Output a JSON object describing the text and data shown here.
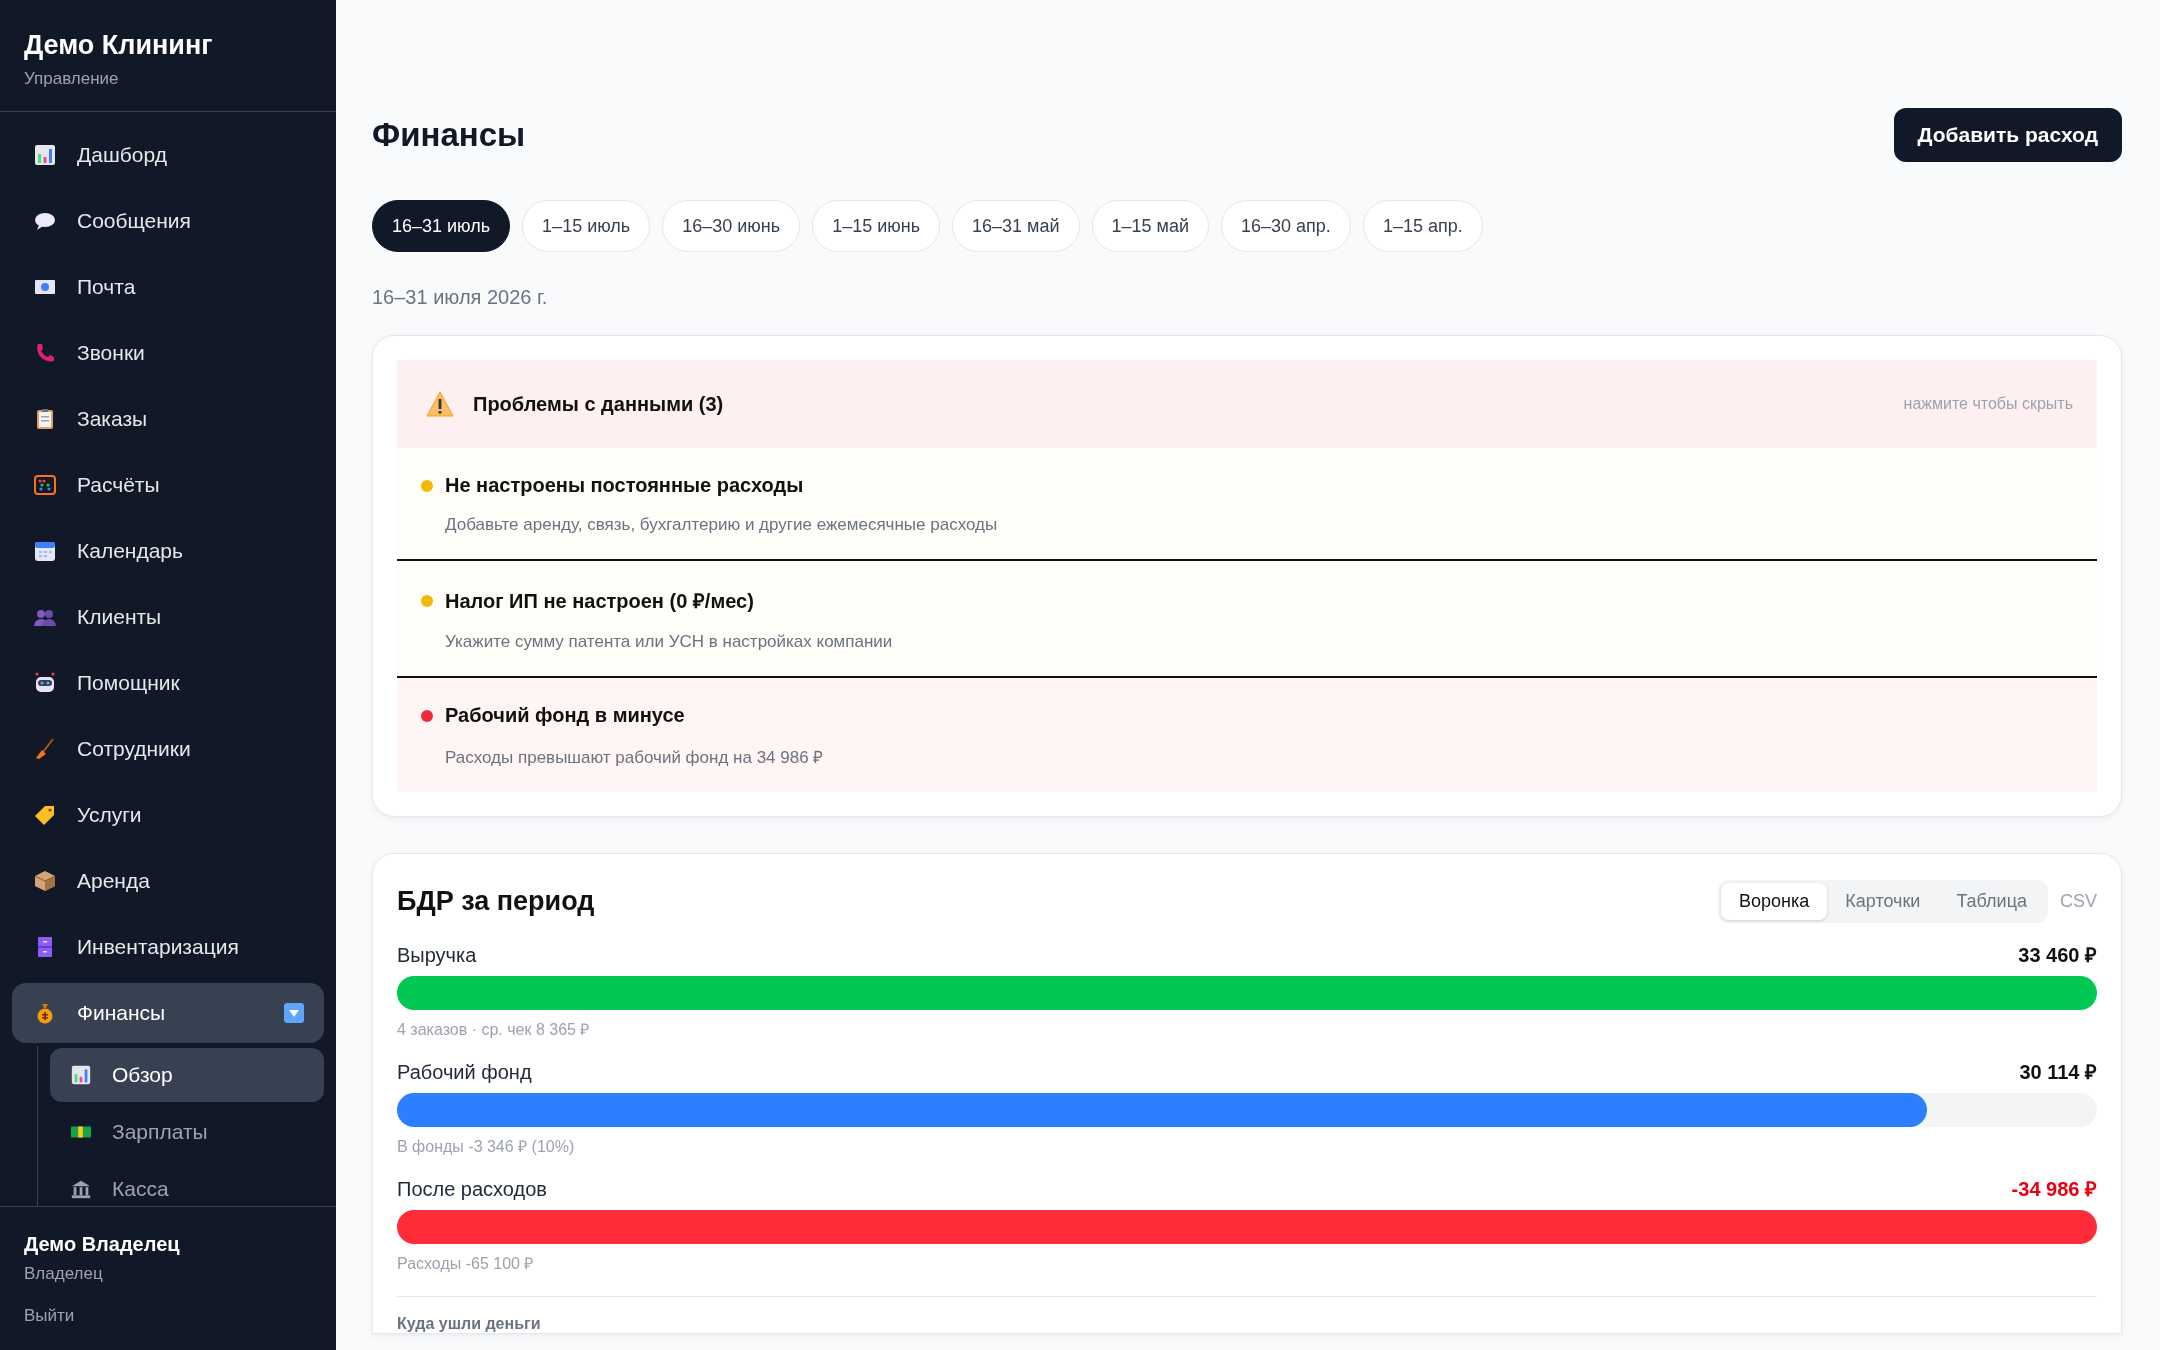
{
  "sidebar": {
    "title": "Демо Клининг",
    "subtitle": "Управление",
    "items": [
      {
        "label": "Дашборд",
        "selected": false
      },
      {
        "label": "Сообщения",
        "selected": false
      },
      {
        "label": "Почта",
        "selected": false
      },
      {
        "label": "Звонки",
        "selected": false
      },
      {
        "label": "Заказы",
        "selected": false
      },
      {
        "label": "Расчёты",
        "selected": false
      },
      {
        "label": "Календарь",
        "selected": false
      },
      {
        "label": "Клиенты",
        "selected": false
      },
      {
        "label": "Помощник",
        "selected": false
      },
      {
        "label": "Сотрудники",
        "selected": false
      },
      {
        "label": "Услуги",
        "selected": false
      },
      {
        "label": "Аренда",
        "selected": false
      },
      {
        "label": "Инвентаризация",
        "selected": false
      },
      {
        "label": "Финансы",
        "selected": true,
        "expanded": true,
        "children": [
          {
            "label": "Обзор",
            "selected": true
          },
          {
            "label": "Зарплаты",
            "selected": false
          },
          {
            "label": "Касса",
            "selected": false
          }
        ]
      }
    ],
    "user": {
      "name": "Демо Владелец",
      "role": "Владелец",
      "logout": "Выйти"
    }
  },
  "page": {
    "title": "Финансы",
    "add_button": "Добавить расход",
    "periods": [
      {
        "label": "16–31 июль",
        "selected": true
      },
      {
        "label": "1–15 июль",
        "selected": false
      },
      {
        "label": "16–30 июнь",
        "selected": false
      },
      {
        "label": "1–15 июнь",
        "selected": false
      },
      {
        "label": "16–31 май",
        "selected": false
      },
      {
        "label": "1–15 май",
        "selected": false
      },
      {
        "label": "16–30 апр.",
        "selected": false
      },
      {
        "label": "1–15 апр.",
        "selected": false
      }
    ],
    "period_caption": "16–31 июля 2026 г."
  },
  "issues": {
    "title": "Проблемы с данными (3)",
    "hint": "нажмите чтобы скрыть",
    "items": [
      {
        "kind": "warning",
        "title": "Не настроены постоянные расходы",
        "text": "Добавьте аренду, связь, бухгалтерию и другие ежемесячные расходы"
      },
      {
        "kind": "warning",
        "title": "Налог ИП не настроен (0 ₽/мес)",
        "text": "Укажите сумму патента или УСН в настройках компании"
      },
      {
        "kind": "error",
        "title": "Рабочий фонд в минусе",
        "text": "Расходы превышают рабочий фонд на 34 986 ₽"
      }
    ]
  },
  "pnl": {
    "title": "БДР за период",
    "views": [
      {
        "label": "Воронка",
        "selected": true
      },
      {
        "label": "Карточки",
        "selected": false
      },
      {
        "label": "Таблица",
        "selected": false
      }
    ],
    "export": "CSV",
    "rows": [
      {
        "label": "Выручка",
        "value": "33 460 ₽",
        "negative": false,
        "level": 1,
        "color": "#00c853",
        "note": "4 заказов · ср. чек 8 365 ₽"
      },
      {
        "label": "Рабочий фонд",
        "value": "30 114 ₽",
        "negative": false,
        "level": 0.9,
        "color": "#2d7fff",
        "note": "В фонды -3 346 ₽ (10%)"
      },
      {
        "label": "После расходов",
        "value": "-34 986 ₽",
        "negative": true,
        "level": 1,
        "color": "#ff2d3a",
        "note": "Расходы -65 100 ₽"
      }
    ],
    "section": "Куда ушли деньги"
  }
}
